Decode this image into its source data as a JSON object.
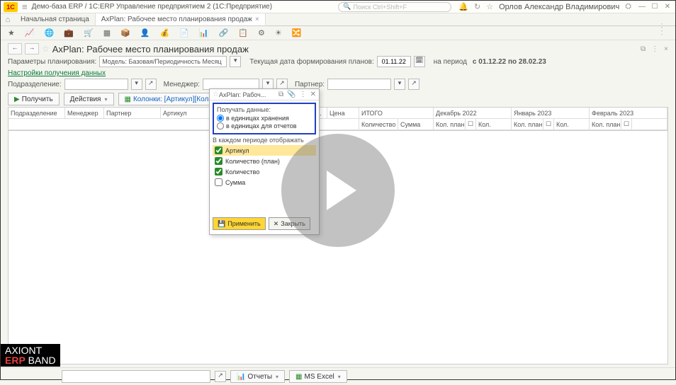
{
  "title": "Демо-база ERP / 1С:ERP Управление предприятием 2  (1С:Предприятие)",
  "search_placeholder": "Поиск Ctrl+Shift+F",
  "user": "Орлов Александр Владимирович",
  "tabs": {
    "home": "Начальная страница",
    "active": "AxPlan: Рабочее место планирования продаж"
  },
  "page_title": "AxPlan: Рабочее место планирования продаж",
  "params": {
    "label": "Параметры планирования:",
    "model": "Модель: Базовая/Периодичность Месяц",
    "date_label": "Текущая дата формирования планов:",
    "date": "01.11.22",
    "period_label": "на период",
    "period": "с 01.12.22 по 28.02.23"
  },
  "settings_link": "Настройки получения данных",
  "filters": {
    "podrazd": "Подразделение:",
    "manager": "Менеджер:",
    "partner": "Партнер:"
  },
  "actions": {
    "get": "Получить",
    "act": "Действия",
    "cols": "Колонки: [Артикул][Количество (план)][Количеств..."
  },
  "grid": {
    "h1": [
      "Подразделение",
      "Менеджер",
      "Партнер",
      "Артикул",
      "Ед.",
      "Цена",
      "ИТОГО",
      "Декабрь 2022",
      "Январь 2023",
      "Февраль 2023"
    ],
    "h2_itogo_kol": "Количество",
    "h2_itogo_sum": "Сумма",
    "h2_kolplan": "Кол. план",
    "h2_kol": "Кол."
  },
  "bottom": {
    "reports": "Отчеты",
    "excel": "MS Excel"
  },
  "dialog": {
    "title": "AxPlan: Рабоч...",
    "radio_label": "Получать данные:",
    "r1": "в единицах хранения",
    "r2": "в единицах для отчетов",
    "sect": "В каждом периоде отображать",
    "c1": "Артикул",
    "c2": "Количество (план)",
    "c3": "Количество",
    "c4": "Сумма",
    "apply": "Применить",
    "close": "Закрыть"
  },
  "badge": {
    "line1": "AXIONT",
    "line2a": "ERP",
    "line2b": " BAND"
  }
}
